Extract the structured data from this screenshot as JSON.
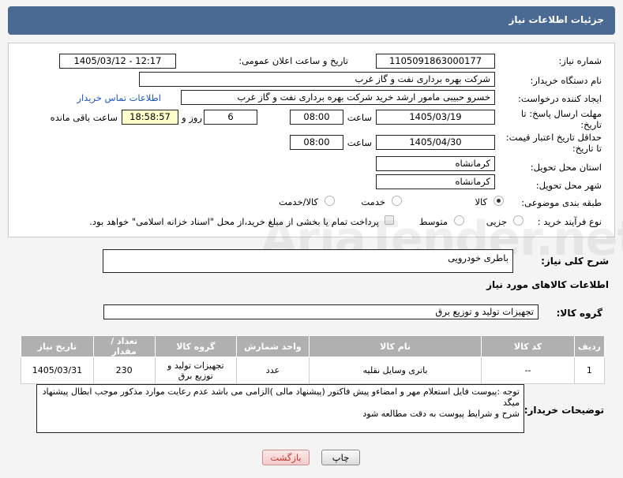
{
  "header": {
    "title": "جزئیات اطلاعات نیاز"
  },
  "form": {
    "need_number_label": "شماره نیاز:",
    "need_number": "1105091863000177",
    "announce_label": "تاریخ و ساعت اعلان عمومی:",
    "announce_value": "1405/03/12 - 12:17",
    "buyer_org_label": "نام دستگاه خریدار:",
    "buyer_org": "شرکت بهره برداری نفت و گاز غرب",
    "creator_label": "ایجاد کننده درخواست:",
    "creator": "خسرو حبیبی مامور ارشد خرید شرکت بهره برداری نفت و گاز غرب",
    "contact_link": "اطلاعات تماس خریدار",
    "reply_deadline_label_1": "مهلت ارسال پاسخ: تا",
    "reply_deadline_label_2": "تاریخ:",
    "reply_date": "1405/03/19",
    "time_label": "ساعت",
    "reply_time": "08:00",
    "days_value": "6",
    "days_label": "روز و",
    "remaining_time": "18:58:57",
    "remaining_label": "ساعت باقی مانده",
    "validity_label_1": "حداقل تاریخ اعتبار قیمت:",
    "validity_label_2": "تا تاریخ:",
    "validity_date": "1405/04/30",
    "validity_time": "08:00",
    "province_label": "استان محل تحویل:",
    "province": "کرمانشاه",
    "city_label": "شهر محل تحویل:",
    "city": "کرمانشاه",
    "category_label": "طبقه بندی موضوعی:",
    "category_options": [
      "کالا",
      "خدمت",
      "کالا/خدمت"
    ],
    "process_label": "نوع فرآیند خرید :",
    "process_options": [
      "جزیی",
      "متوسط"
    ],
    "payment_note": "پرداخت تمام یا بخشی از مبلغ خرید،از محل \"اسناد خزانه اسلامی\" خواهد بود."
  },
  "summary": {
    "label": "شرح کلی نیاز:",
    "value": "باطری خودرویی"
  },
  "goods": {
    "section_title": "اطلاعات کالاهای مورد نیاز",
    "group_label": "گروه کالا:",
    "group_value": "تجهیزات تولید و توزیع برق",
    "table": {
      "headers": [
        "ردیف",
        "کد کالا",
        "نام کالا",
        "واحد شمارش",
        "گروه کالا",
        "تعداد / مقدار",
        "تاریخ نیاز"
      ],
      "rows": [
        [
          "1",
          "--",
          "باتری وسایل نقلیه",
          "عدد",
          "تجهیزات تولید و توزیع برق",
          "230",
          "1405/03/31"
        ]
      ]
    }
  },
  "notes": {
    "label": "توضیحات خریدار:",
    "line1": "توجه :پیوست فایل استعلام مهر و امضاءو پیش فاکتور (پیشنهاد مالی )الزامی می باشد عدم رعایت موارد مذکور موجب ابطال پیشنهاد میگد",
    "line2": "شرح و شرایط پیوست به دقت مطالعه شود"
  },
  "buttons": {
    "print": "چاپ",
    "back": "بازگشت"
  },
  "watermark": "AriaTender.net"
}
